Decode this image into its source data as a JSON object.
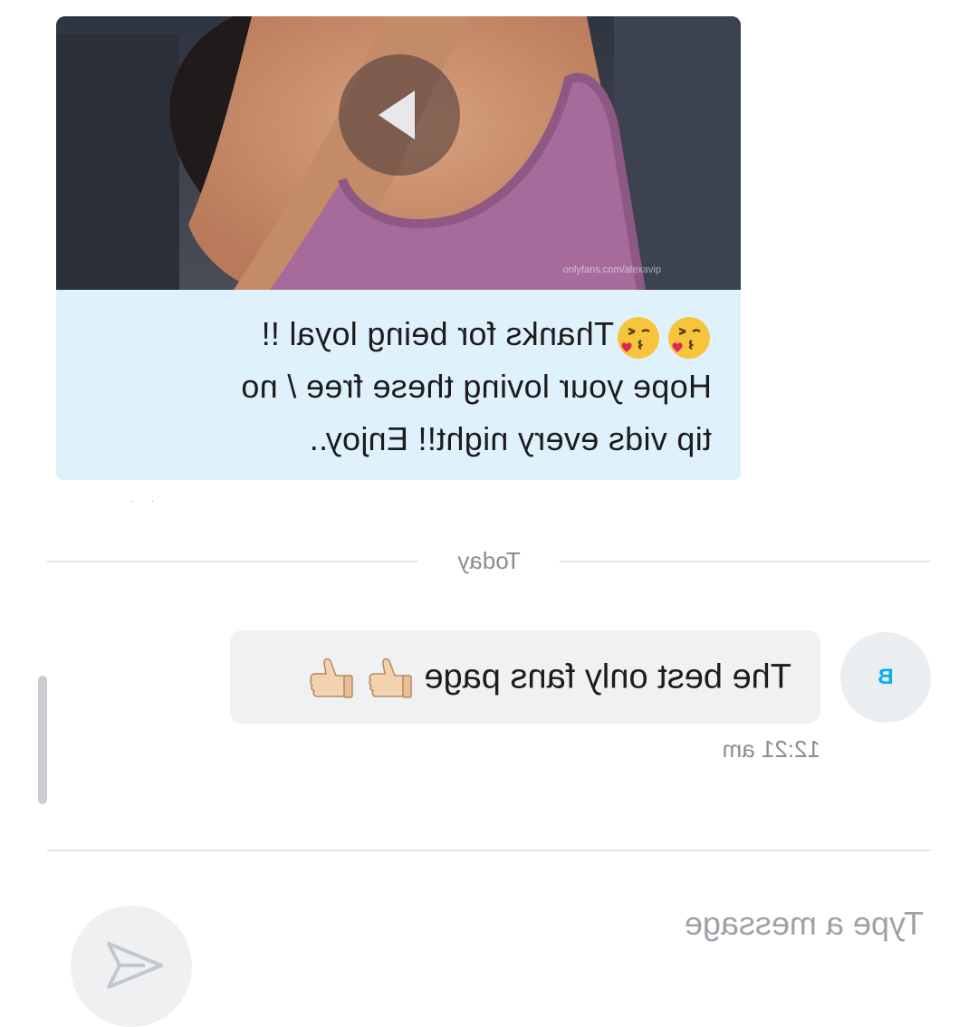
{
  "chat": {
    "incoming_media": {
      "type": "video",
      "watermark": "onlyfans.com/alexavip",
      "caption": "Thanks for being loyal !!\nHope your loving these free / no\ntip vids every night!! Enjoy..",
      "caption_emoji": [
        "face-blowing-kiss",
        "face-blowing-kiss"
      ],
      "bubble_color": "#dff1fb"
    },
    "date_divider": "Today",
    "outgoing": {
      "avatar_initial": "B",
      "text": "The best only fans page",
      "emoji": [
        "thumbs-up",
        "thumbs-up"
      ],
      "timestamp": "12:21 am",
      "bubble_color": "#f0f1f3"
    }
  },
  "composer": {
    "placeholder": "Type a message",
    "send_icon": "send-arrow-icon"
  },
  "colors": {
    "accent": "#00aff0",
    "muted_text": "#8a8d93"
  }
}
